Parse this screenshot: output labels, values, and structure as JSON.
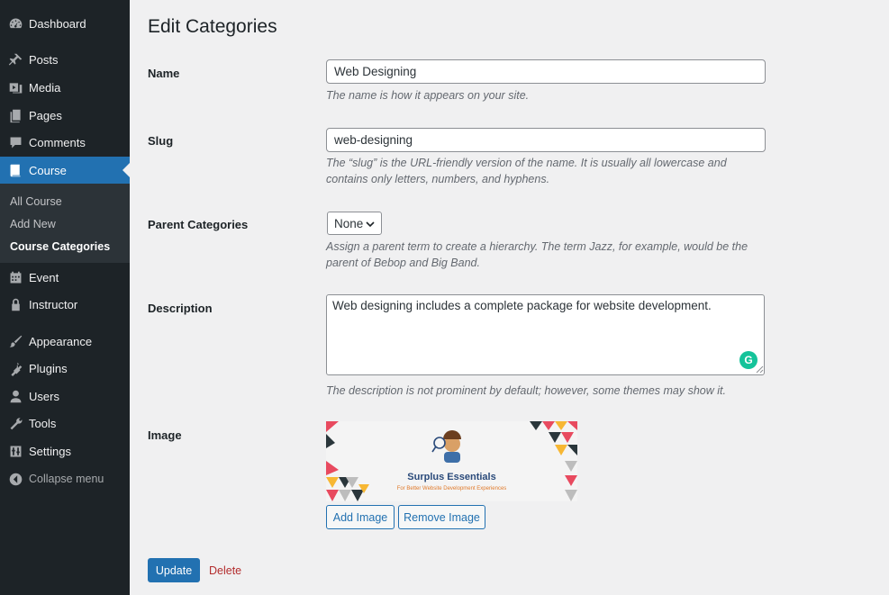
{
  "sidebar": {
    "items": [
      {
        "label": "Dashboard",
        "icon": "dashboard-icon"
      },
      {
        "label": "Posts",
        "icon": "pin-icon"
      },
      {
        "label": "Media",
        "icon": "media-icon"
      },
      {
        "label": "Pages",
        "icon": "pages-icon"
      },
      {
        "label": "Comments",
        "icon": "comments-icon"
      },
      {
        "label": "Course",
        "icon": "book-icon"
      },
      {
        "label": "Event",
        "icon": "event-icon"
      },
      {
        "label": "Instructor",
        "icon": "lock-icon"
      },
      {
        "label": "Appearance",
        "icon": "brush-icon"
      },
      {
        "label": "Plugins",
        "icon": "plugin-icon"
      },
      {
        "label": "Users",
        "icon": "user-icon"
      },
      {
        "label": "Tools",
        "icon": "wrench-icon"
      },
      {
        "label": "Settings",
        "icon": "settings-icon"
      }
    ],
    "submenu": [
      "All Course",
      "Add New",
      "Course Categories"
    ],
    "collapse_label": "Collapse menu"
  },
  "main": {
    "title": "Edit Categories",
    "name": {
      "label": "Name",
      "value": "Web Designing",
      "help": "The name is how it appears on your site."
    },
    "slug": {
      "label": "Slug",
      "value": "web-designing",
      "help": "The “slug” is the URL-friendly version of the name. It is usually all lowercase and contains only letters, numbers, and hyphens."
    },
    "parent": {
      "label": "Parent Categories",
      "selected": "None",
      "help": "Assign a parent term to create a hierarchy. The term Jazz, for example, would be the parent of Bebop and Big Band."
    },
    "description": {
      "label": "Description",
      "value": "Web designing includes a complete package for website development.",
      "help": "The description is not prominent by default; however, some themes may show it."
    },
    "image": {
      "label": "Image",
      "banner_title": "Surplus Essentials",
      "banner_subtitle": "For Better Website Development Experiences",
      "add_label": "Add Image",
      "remove_label": "Remove Image"
    },
    "update_label": "Update",
    "delete_label": "Delete"
  },
  "colors": {
    "sidebar_bg": "#1d2327",
    "accent": "#2271b1",
    "delete": "#b32d2e"
  }
}
